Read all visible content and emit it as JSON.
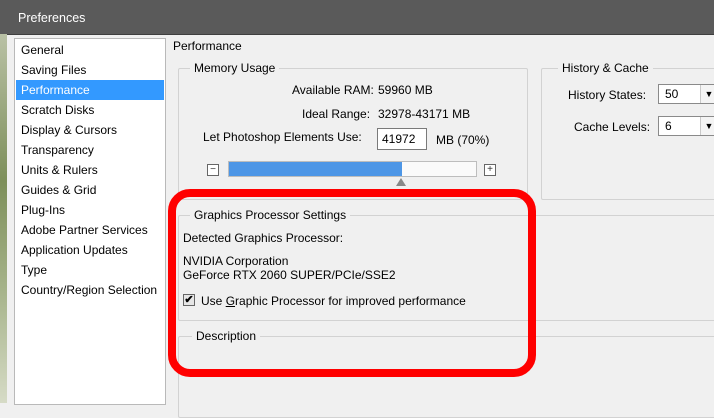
{
  "window": {
    "title": "Preferences"
  },
  "sidebar": {
    "items": [
      {
        "label": "General"
      },
      {
        "label": "Saving Files"
      },
      {
        "label": "Performance",
        "selected": true
      },
      {
        "label": "Scratch Disks"
      },
      {
        "label": "Display & Cursors"
      },
      {
        "label": "Transparency"
      },
      {
        "label": "Units & Rulers"
      },
      {
        "label": "Guides & Grid"
      },
      {
        "label": "Plug-Ins"
      },
      {
        "label": "Adobe Partner Services"
      },
      {
        "label": "Application Updates"
      },
      {
        "label": "Type"
      },
      {
        "label": "Country/Region Selection"
      }
    ]
  },
  "page": {
    "title": "Performance"
  },
  "memory": {
    "legend": "Memory Usage",
    "available_label": "Available RAM:",
    "available_value": "59960 MB",
    "ideal_label": "Ideal Range:",
    "ideal_value": "32978-43171 MB",
    "use_label": "Let Photoshop Elements Use:",
    "use_value": "41972",
    "use_unit": "MB (70%)",
    "slider_level_percent": 70,
    "minus_glyph": "−",
    "plus_glyph": "+"
  },
  "history": {
    "legend": "History & Cache",
    "states_label": "History States:",
    "states_value": "50",
    "levels_label": "Cache Levels:",
    "levels_value": "6"
  },
  "gpu": {
    "legend": "Graphics Processor Settings",
    "detected_label": "Detected Graphics Processor:",
    "vendor": "NVIDIA Corporation",
    "model": "GeForce RTX 2060 SUPER/PCIe/SSE2",
    "checkbox_checked": true,
    "checkbox_pre": "Use ",
    "checkbox_ul": "G",
    "checkbox_post": "raphic Processor for improved performance"
  },
  "description": {
    "legend": "Description"
  },
  "colors": {
    "selection": "#3399ff",
    "slider_fill": "#4d96e6",
    "highlight": "#ff0000",
    "titlebar": "#5a5a5a"
  }
}
